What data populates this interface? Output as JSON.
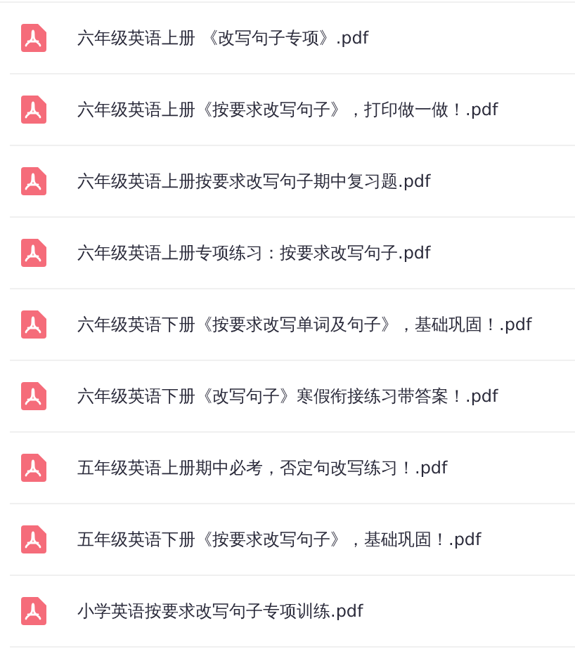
{
  "files": [
    {
      "name": "六年级英语上册 《改写句子专项》.pdf"
    },
    {
      "name": "六年级英语上册《按要求改写句子》，打印做一做！.pdf"
    },
    {
      "name": "六年级英语上册按要求改写句子期中复习题.pdf"
    },
    {
      "name": "六年级英语上册专项练习：按要求改写句子.pdf"
    },
    {
      "name": "六年级英语下册《按要求改写单词及句子》，基础巩固！.pdf"
    },
    {
      "name": "六年级英语下册《改写句子》寒假衔接练习带答案！.pdf"
    },
    {
      "name": "五年级英语上册期中必考，否定句改写练习！.pdf"
    },
    {
      "name": "五年级英语下册《按要求改写句子》，基础巩固！.pdf"
    },
    {
      "name": "小学英语按要求改写句子专项训练.pdf"
    }
  ]
}
